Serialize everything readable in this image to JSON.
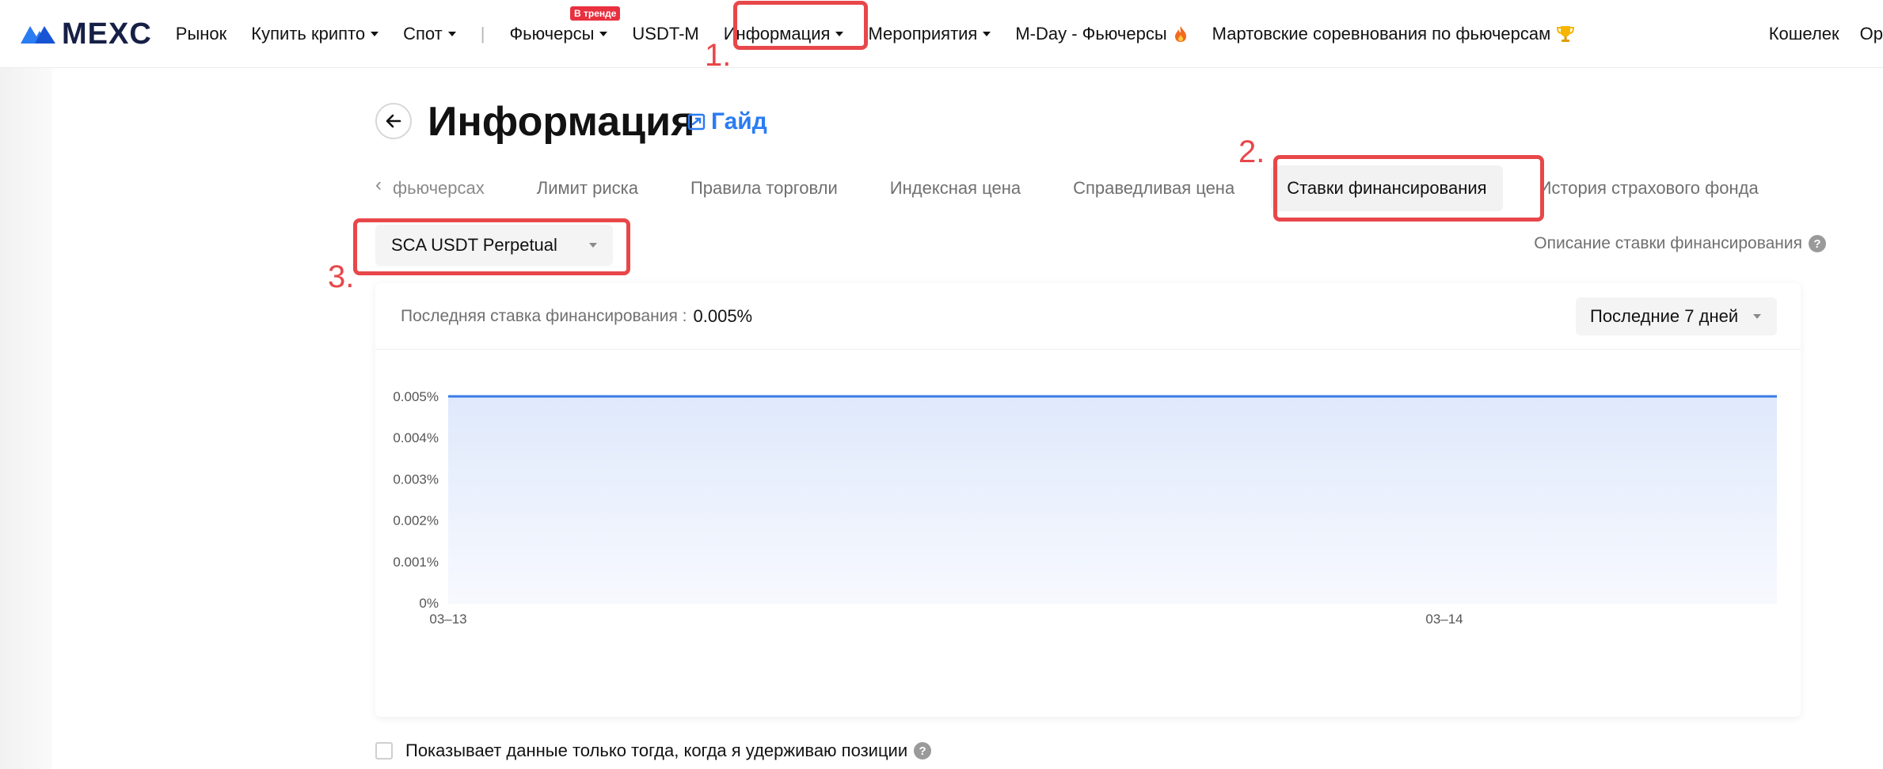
{
  "brand": {
    "name": "MEXC",
    "color": "#162046",
    "accent": "#2a7cf2"
  },
  "nav": {
    "market": "Рынок",
    "buy_crypto": "Купить крипто",
    "spot": "Спот",
    "separator": "|",
    "futures": "Фьючерсы",
    "futures_badge": "В тренде",
    "usdt_m": "USDT-M",
    "info": "Информация",
    "events": "Мероприятия",
    "mday": "M-Day - Фьючерсы",
    "mday_icon": "fire-icon",
    "march": "Мартовские соревнования по фьючерсам",
    "march_icon": "trophy-icon",
    "wallet": "Кошелек",
    "orders_cut": "Ор"
  },
  "annotations": {
    "n1": "1.",
    "n2": "2.",
    "n3": "3.",
    "color": "#e8474a"
  },
  "page": {
    "title": "Информация",
    "guide": "Гайд"
  },
  "tabs": [
    {
      "label": "фьючерсах"
    },
    {
      "label": "Лимит риска"
    },
    {
      "label": "Правила торговли"
    },
    {
      "label": "Индексная цена"
    },
    {
      "label": "Справедливая цена"
    },
    {
      "label": "Ставки финансирования",
      "active": true
    },
    {
      "label": "История страхового фонда"
    }
  ],
  "contract_select": {
    "value": "SCA USDT Perpetual"
  },
  "rate_description": "Описание ставки финансирования",
  "card": {
    "last_rate_label": "Последняя ставка финансирования :",
    "last_rate_value": "0.005%",
    "period": "Последние 7 дней"
  },
  "chart_data": {
    "type": "area",
    "x": [
      "03–13",
      "03–14"
    ],
    "x_ticks": [
      "03–13",
      "03–14"
    ],
    "series": [
      {
        "values": [
          0.005,
          0.005
        ]
      }
    ],
    "y_ticks": [
      "0%",
      "0.001%",
      "0.002%",
      "0.003%",
      "0.004%",
      "0.005%"
    ],
    "ylim": [
      0,
      0.005
    ],
    "grid": true,
    "line_color": "#3a7be6",
    "fill_color": "#e4edfc"
  },
  "only_positions": "Показывает данные только тогда, когда я удерживаю позиции"
}
